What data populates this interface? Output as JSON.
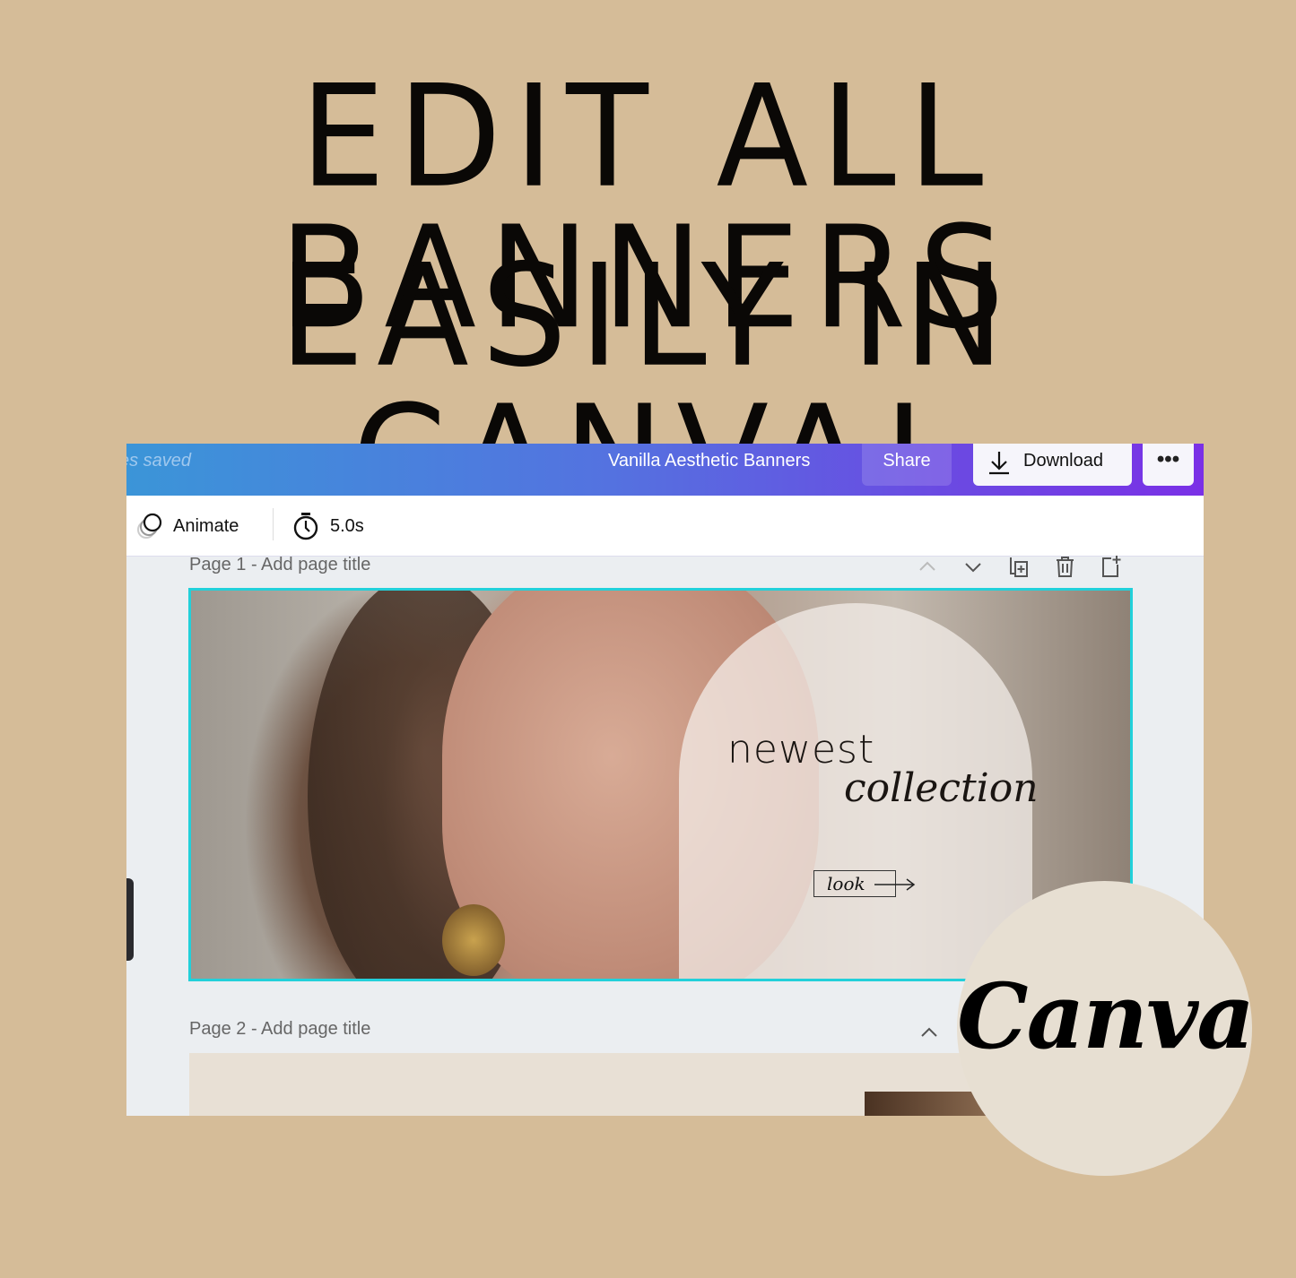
{
  "headline": {
    "line1": "EDIT ALL BANNERS",
    "line2": "EASILY IN CANVA!"
  },
  "topbar": {
    "saved_text": "es saved",
    "title": "Vanilla Aesthetic Banners",
    "share": "Share",
    "download": "Download",
    "more": "•••",
    "gradient": [
      "#3b95d8",
      "#7a30e6"
    ]
  },
  "toolbar": {
    "animate": "Animate",
    "duration": "5.0s"
  },
  "pages": [
    {
      "label": "Page 1 - Add page title"
    },
    {
      "label": "Page 2 - Add page title"
    }
  ],
  "banner": {
    "line1": "newest",
    "line2": "collection",
    "button": "look",
    "selection_color": "#22d0da"
  },
  "badge": {
    "logo_text": "Canva"
  }
}
